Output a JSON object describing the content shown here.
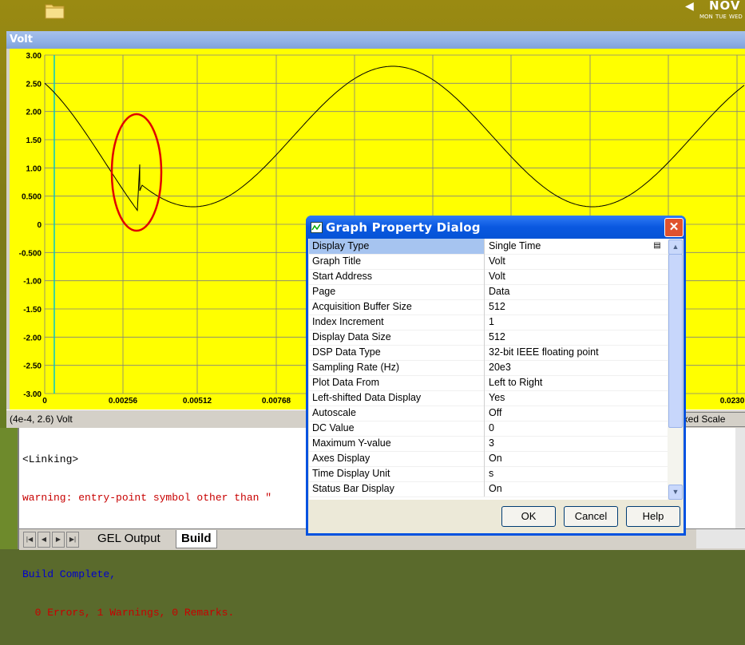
{
  "desktop": {
    "clock_month": "NOV",
    "clock_days": "MON TUE WED",
    "icons": [
      "folder-icon"
    ]
  },
  "graph_window": {
    "title": "Volt",
    "status_coord": "(4e-4, 2.6)  Volt",
    "status_right": "ixed Scale",
    "y_tick_labels": [
      "3.00",
      "2.50",
      "2.00",
      "1.50",
      "1.00",
      "0.500",
      "0",
      "-0.500",
      "-1.00",
      "-1.50",
      "-2.00",
      "-2.50",
      "-3.00"
    ],
    "x_tick_labels": [
      "0",
      "0.00256",
      "0.00512",
      "0.00768",
      "0.0230"
    ],
    "colors": {
      "plot_bg": "#ffff00",
      "grid": "#808080",
      "trace": "#000000",
      "cursor": "#00c8c8",
      "annotation": "#e00000"
    }
  },
  "build_window": {
    "lines": [
      {
        "text": "<Linking>",
        "color": "black"
      },
      {
        "text": "warning: entry-point symbol other than \"",
        "color": "red"
      },
      {
        "text": "",
        "color": "black"
      },
      {
        "text": "Build Complete,",
        "color": "blue"
      },
      {
        "text": "  0 Errors, 1 Warnings, 0 Remarks.",
        "color": "red"
      }
    ],
    "tabs": [
      "GEL Output",
      "Build"
    ]
  },
  "dialog": {
    "title": "Graph Property Dialog",
    "rows": [
      {
        "key": "Display Type",
        "value": "Single Time"
      },
      {
        "key": "Graph Title",
        "value": "Volt"
      },
      {
        "key": "Start Address",
        "value": "Volt"
      },
      {
        "key": "Page",
        "value": "Data"
      },
      {
        "key": "Acquisition Buffer Size",
        "value": "512"
      },
      {
        "key": "Index Increment",
        "value": "1"
      },
      {
        "key": "Display Data Size",
        "value": "512"
      },
      {
        "key": "DSP Data Type",
        "value": "32-bit IEEE floating point"
      },
      {
        "key": "Sampling Rate (Hz)",
        "value": "20e3"
      },
      {
        "key": "Plot Data From",
        "value": "Left to Right"
      },
      {
        "key": "Left-shifted Data Display",
        "value": "Yes"
      },
      {
        "key": "Autoscale",
        "value": "Off"
      },
      {
        "key": "DC Value",
        "value": "0"
      },
      {
        "key": "Maximum Y-value",
        "value": "3"
      },
      {
        "key": "Axes Display",
        "value": "On"
      },
      {
        "key": "Time Display Unit",
        "value": "s"
      },
      {
        "key": "Status Bar Display",
        "value": "On"
      }
    ],
    "buttons": {
      "ok": "OK",
      "cancel": "Cancel",
      "help": "Help"
    }
  }
}
